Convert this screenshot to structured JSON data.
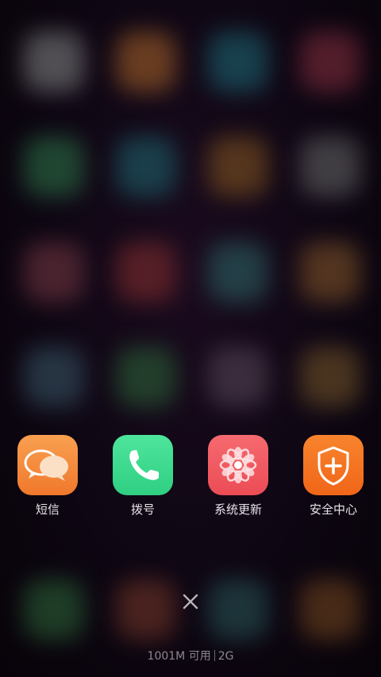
{
  "recent_apps": [
    {
      "label": "短信",
      "icon": "message-bubbles-icon",
      "color": "#F48A3D"
    },
    {
      "label": "拨号",
      "icon": "phone-handset-icon",
      "color": "#3DD68C"
    },
    {
      "label": "系统更新",
      "icon": "atom-flower-icon",
      "color": "#F0585F"
    },
    {
      "label": "安全中心",
      "icon": "shield-plus-icon",
      "color": "#F47223"
    }
  ],
  "close_button": {
    "icon": "close-x-icon"
  },
  "memory": {
    "available": "1001M 可用",
    "total": "2G"
  }
}
